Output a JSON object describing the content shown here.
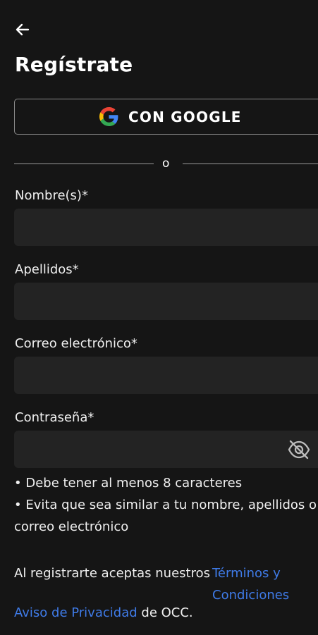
{
  "header": {
    "back_icon": "arrow-left-icon",
    "title": "Regístrate"
  },
  "google": {
    "icon": "google-logo-icon",
    "label": "CON GOOGLE"
  },
  "divider": {
    "text": "o"
  },
  "form": {
    "nombre_label": "Nombre(s)*",
    "nombre_value": "",
    "apellidos_label": "Apellidos*",
    "apellidos_value": "",
    "correo_label": "Correo electrónico*",
    "correo_value": "",
    "password_label": "Contraseña*",
    "password_value": "",
    "password_toggle_icon": "eye-off-icon"
  },
  "hints": [
    "• Debe tener al menos 8 caracteres",
    "• Evita que sea similar a tu nombre, apellidos o correo electrónico"
  ],
  "terms": {
    "prefix": "Al registrarte aceptas nuestros",
    "terms_link": "Términos y Condiciones",
    "privacy_link": "Aviso de Privacidad",
    "suffix": "de OCC."
  },
  "colors": {
    "background": "#151515",
    "field_background": "#232323",
    "link": "#3f7be8"
  }
}
